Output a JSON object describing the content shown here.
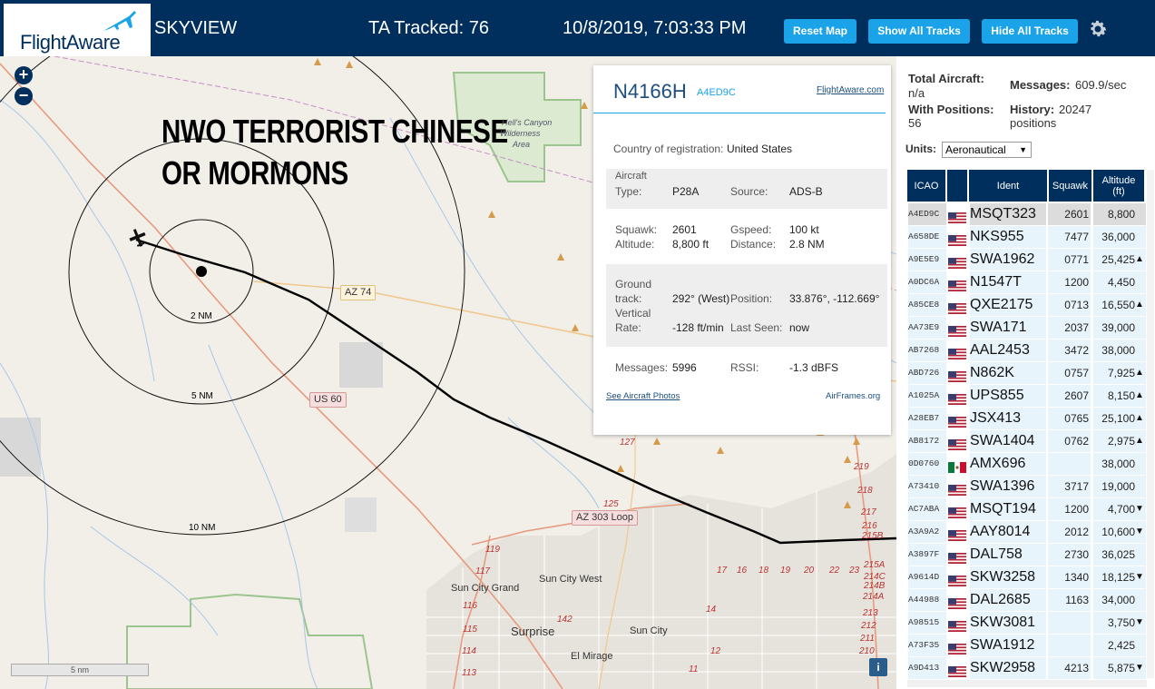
{
  "header": {
    "logo_text": "FlightAware",
    "app_name": "SKYVIEW",
    "tracked_label": "TA Tracked: 76",
    "datetime": "10/8/2019, 7:03:33 PM",
    "reset_map": "Reset Map",
    "show_all": "Show All Tracks",
    "hide_all": "Hide All Tracks"
  },
  "map": {
    "overlay_line1": "NWO TERRORIST CHINESE",
    "overlay_line2": "OR MORMONS",
    "zoom_in": "+",
    "zoom_out": "−",
    "ring_labels": [
      "2 NM",
      "5 NM",
      "10 NM"
    ],
    "roads": [
      "AZ 74",
      "US 60",
      "AZ 303 Loop"
    ],
    "towns": [
      "Sun City West",
      "Sun City Grand",
      "Surprise",
      "Sun City",
      "El Mirage"
    ],
    "wilderness": [
      "Hell's Canyon",
      "Wilderness",
      "Area"
    ],
    "exits": [
      "127",
      "125",
      "119",
      "117",
      "116",
      "115",
      "114",
      "113",
      "142",
      "14",
      "17",
      "16",
      "18",
      "19",
      "20",
      "22",
      "23",
      "219",
      "218",
      "217",
      "216",
      "215B",
      "215A",
      "214C",
      "214B",
      "214A",
      "213",
      "212",
      "211",
      "210",
      "11",
      "12"
    ],
    "scale": "5 nm",
    "info": "i"
  },
  "popup": {
    "registration": "N4166H",
    "hex": "A4ED9C",
    "fa_link": "FlightAware.com",
    "country_label": "Country of registration:",
    "country": "United States",
    "aircraft_label": "Aircraft",
    "type_label": "Type:",
    "type": "P28A",
    "source_label": "Source:",
    "source": "ADS-B",
    "squawk_label": "Squawk:",
    "squawk": "2601",
    "gspeed_label": "Gspeed:",
    "gspeed": "100 kt",
    "altitude_label": "Altitude:",
    "altitude": "8,800 ft",
    "distance_label": "Distance:",
    "distance": "2.8 NM",
    "ground_label": "Ground",
    "track_label": "track:",
    "track": "292° (West)",
    "position_label": "Position:",
    "position": "33.876°, -112.669°",
    "vertical_label": "Vertical",
    "rate_label": "Rate:",
    "rate": "-128 ft/min",
    "lastseen_label": "Last Seen:",
    "lastseen": "now",
    "messages_label": "Messages:",
    "messages": "5996",
    "rssi_label": "RSSI:",
    "rssi": "-1.3 dBFS",
    "photos_link": "See Aircraft Photos",
    "airframes_link": "AirFrames.org"
  },
  "sidebar": {
    "total_label": "Total Aircraft:",
    "total_value": "n/a",
    "messages_label": "Messages:",
    "messages_value": "609.9/sec",
    "positions_label": "With Positions:",
    "positions_value": "56",
    "history_label": "History:",
    "history_value": "20247",
    "history_unit": "positions",
    "units_label": "Units:",
    "units_value": "Aeronautical"
  },
  "table": {
    "headers": [
      "ICAO",
      "",
      "Ident",
      "Squawk",
      "Altitude (ft)"
    ],
    "rows": [
      {
        "icao": "A4ED9C",
        "flag": "us",
        "ident": "MSQT323",
        "squawk": "2601",
        "alt": "8,800",
        "trend": ""
      },
      {
        "icao": "A658DE",
        "flag": "us",
        "ident": "NKS955",
        "squawk": "7477",
        "alt": "36,000",
        "trend": ""
      },
      {
        "icao": "A9E5E9",
        "flag": "us",
        "ident": "SWA1962",
        "squawk": "0771",
        "alt": "25,425",
        "trend": "▲"
      },
      {
        "icao": "A0DC6A",
        "flag": "us",
        "ident": "N1547T",
        "squawk": "1200",
        "alt": "4,450",
        "trend": ""
      },
      {
        "icao": "A85CE8",
        "flag": "us",
        "ident": "QXE2175",
        "squawk": "0713",
        "alt": "16,550",
        "trend": "▲"
      },
      {
        "icao": "AA73E9",
        "flag": "us",
        "ident": "SWA171",
        "squawk": "2037",
        "alt": "39,000",
        "trend": ""
      },
      {
        "icao": "AB7268",
        "flag": "us",
        "ident": "AAL2453",
        "squawk": "3472",
        "alt": "38,000",
        "trend": ""
      },
      {
        "icao": "ABD726",
        "flag": "us",
        "ident": "N862K",
        "squawk": "0757",
        "alt": "7,925",
        "trend": "▲"
      },
      {
        "icao": "A1025A",
        "flag": "us",
        "ident": "UPS855",
        "squawk": "2607",
        "alt": "8,150",
        "trend": "▲"
      },
      {
        "icao": "A28EB7",
        "flag": "us",
        "ident": "JSX413",
        "squawk": "0765",
        "alt": "25,100",
        "trend": "▲"
      },
      {
        "icao": "AB8172",
        "flag": "us",
        "ident": "SWA1404",
        "squawk": "0762",
        "alt": "2,975",
        "trend": "▲"
      },
      {
        "icao": "0D0760",
        "flag": "mx",
        "ident": "AMX696",
        "squawk": "",
        "alt": "38,000",
        "trend": ""
      },
      {
        "icao": "A73410",
        "flag": "us",
        "ident": "SWA1396",
        "squawk": "3717",
        "alt": "19,000",
        "trend": ""
      },
      {
        "icao": "AC7ABA",
        "flag": "us",
        "ident": "MSQT194",
        "squawk": "1200",
        "alt": "4,700",
        "trend": "▼"
      },
      {
        "icao": "A3A9A2",
        "flag": "us",
        "ident": "AAY8014",
        "squawk": "2012",
        "alt": "10,600",
        "trend": "▼"
      },
      {
        "icao": "A3897F",
        "flag": "us",
        "ident": "DAL758",
        "squawk": "2730",
        "alt": "36,025",
        "trend": ""
      },
      {
        "icao": "A9614D",
        "flag": "us",
        "ident": "SKW3258",
        "squawk": "1340",
        "alt": "18,125",
        "trend": "▼"
      },
      {
        "icao": "A44988",
        "flag": "us",
        "ident": "DAL2685",
        "squawk": "1163",
        "alt": "34,000",
        "trend": ""
      },
      {
        "icao": "A98515",
        "flag": "us",
        "ident": "SKW3081",
        "squawk": "",
        "alt": "3,750",
        "trend": "▼"
      },
      {
        "icao": "A73F35",
        "flag": "us",
        "ident": "SWA1912",
        "squawk": "",
        "alt": "2,425",
        "trend": ""
      },
      {
        "icao": "A9D413",
        "flag": "us",
        "ident": "SKW2958",
        "squawk": "4213",
        "alt": "5,875",
        "trend": "▼"
      }
    ]
  },
  "colors": {
    "header_bg": "#002f5d",
    "button_bg": "#1aa3e8",
    "selected_row": "#dcdcdc",
    "row_bg": "#e8f4fb"
  }
}
